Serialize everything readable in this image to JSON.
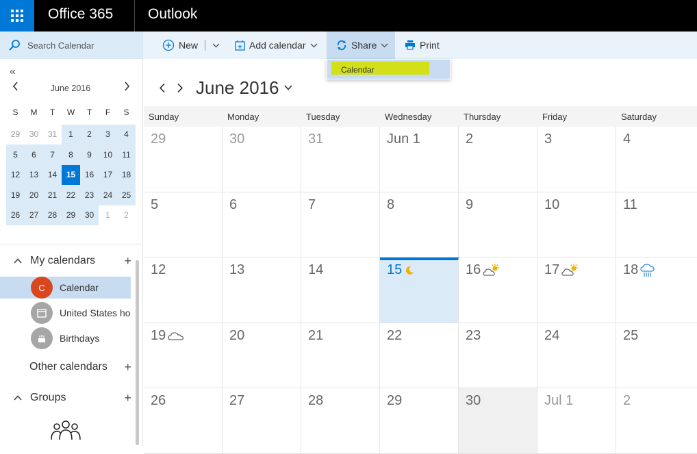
{
  "topbar": {
    "app_name": "Office 365",
    "suite_name": "Outlook"
  },
  "search": {
    "placeholder": "Search Calendar"
  },
  "commands": {
    "new_label": "New",
    "add_calendar_label": "Add calendar",
    "share_label": "Share",
    "print_label": "Print",
    "share_menu": {
      "items": [
        "Calendar"
      ]
    }
  },
  "mini_calendar": {
    "title": "June 2016",
    "days_of_week": [
      "S",
      "M",
      "T",
      "W",
      "T",
      "F",
      "S"
    ],
    "weeks": [
      [
        "29",
        "30",
        "31",
        "1",
        "2",
        "3",
        "4"
      ],
      [
        "5",
        "6",
        "7",
        "8",
        "9",
        "10",
        "11"
      ],
      [
        "12",
        "13",
        "14",
        "15",
        "16",
        "17",
        "18"
      ],
      [
        "19",
        "20",
        "21",
        "22",
        "23",
        "24",
        "25"
      ],
      [
        "26",
        "27",
        "28",
        "29",
        "30",
        "1",
        "2"
      ]
    ],
    "today": "15"
  },
  "sidebar": {
    "my_calendars": "My calendars",
    "calendars": [
      {
        "initial": "C",
        "name": "Calendar",
        "color": "#d9471f"
      },
      {
        "initial": "",
        "name": "United States holi",
        "color": "#a6a6a6"
      },
      {
        "initial": "",
        "name": "Birthdays",
        "color": "#a6a6a6"
      }
    ],
    "other_calendars": "Other calendars",
    "groups": "Groups"
  },
  "main": {
    "title": "June 2016",
    "days_of_week": [
      "Sunday",
      "Monday",
      "Tuesday",
      "Wednesday",
      "Thursday",
      "Friday",
      "Saturday"
    ],
    "weeks": [
      [
        "29",
        "30",
        "31",
        "Jun 1",
        "2",
        "3",
        "4"
      ],
      [
        "5",
        "6",
        "7",
        "8",
        "9",
        "10",
        "11"
      ],
      [
        "12",
        "13",
        "14",
        "15",
        "16",
        "17",
        "18"
      ],
      [
        "19",
        "20",
        "21",
        "22",
        "23",
        "24",
        "25"
      ],
      [
        "26",
        "27",
        "28",
        "29",
        "30",
        "Jul 1",
        "2"
      ]
    ],
    "weather": {
      "15": "moon-icon",
      "16": "partly-cloudy-icon",
      "17": "partly-cloudy-icon",
      "18": "rain-icon",
      "19": "cloud-icon"
    }
  },
  "colors": {
    "accent": "#0078d7",
    "highlight": "#d3e018",
    "selection": "#c7dcf0"
  }
}
